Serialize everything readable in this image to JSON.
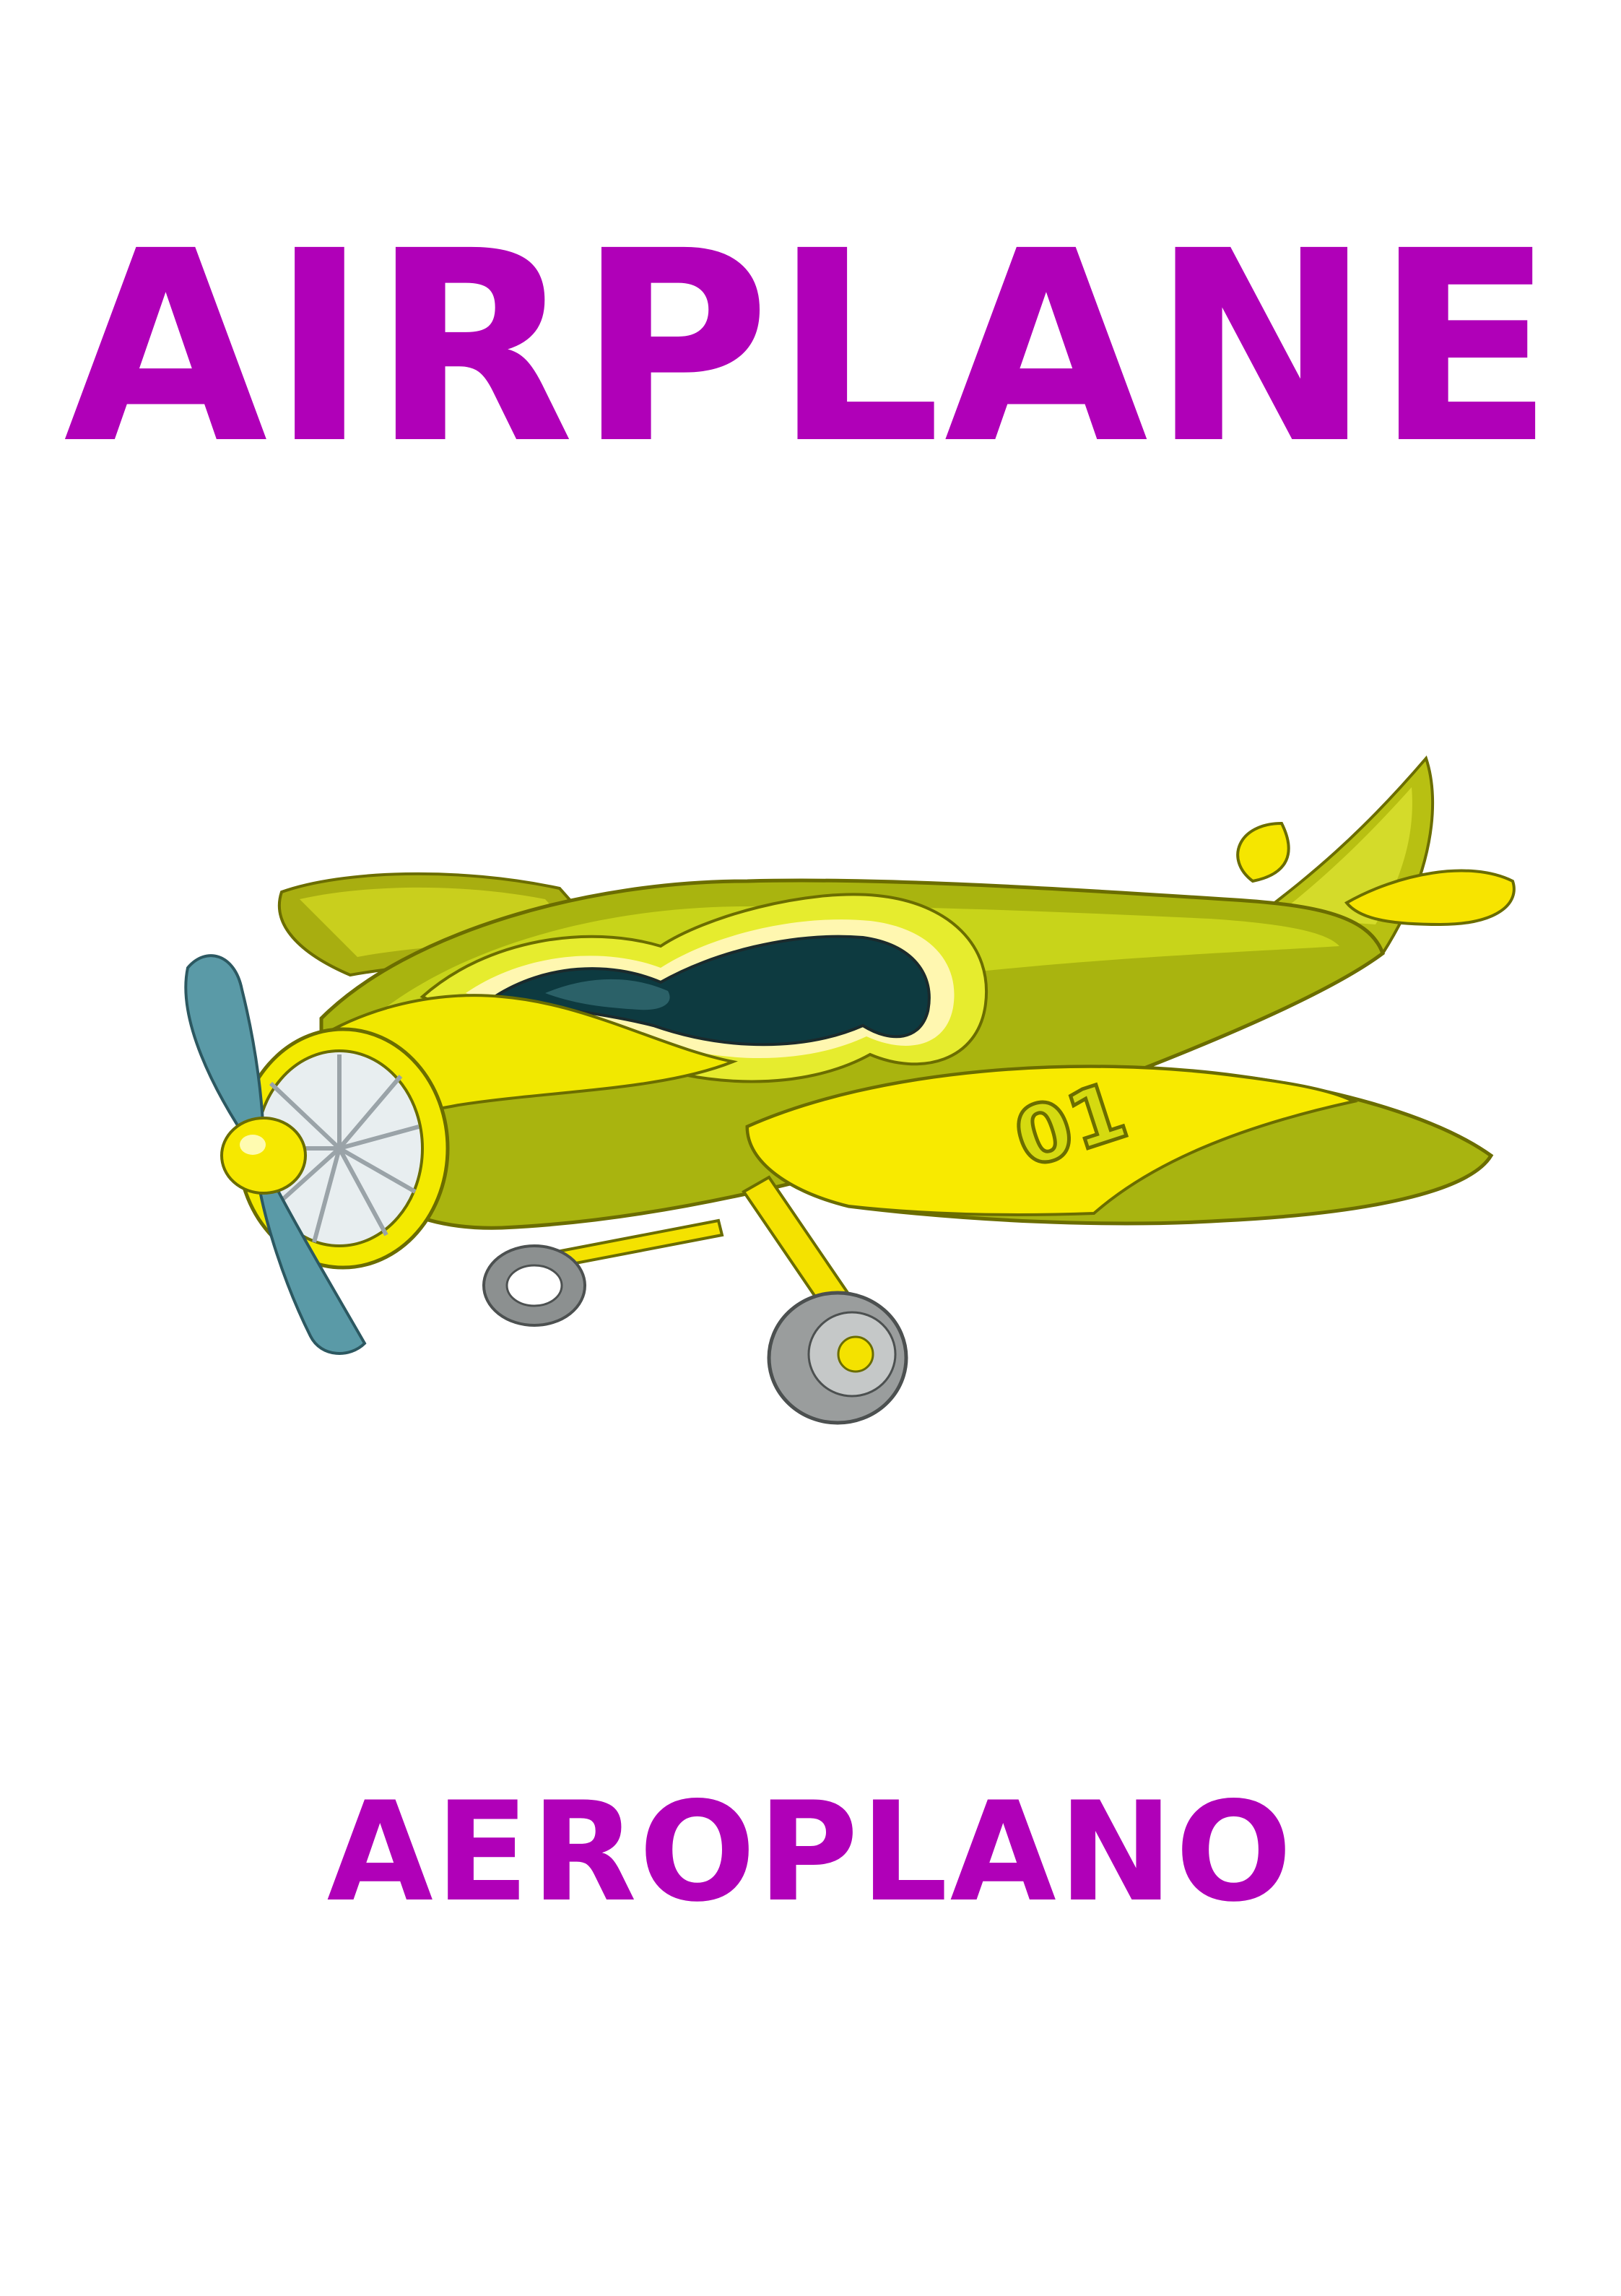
{
  "colors": {
    "accent": "#b000b8",
    "background": "#ffffff"
  },
  "card": {
    "title": "AIRPLANE",
    "subtitle": "AEROPLANO",
    "illustration": {
      "icon": "airplane-icon",
      "tail_number": "01"
    }
  }
}
